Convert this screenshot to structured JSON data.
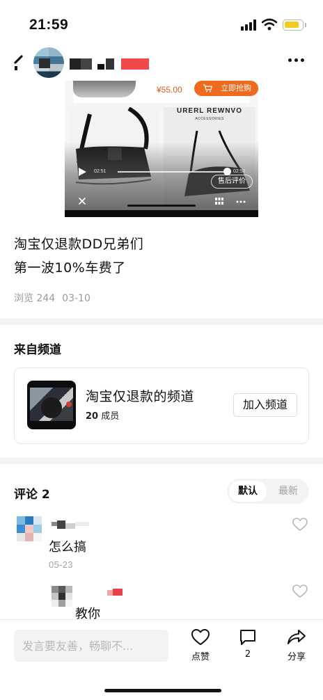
{
  "status_bar": {
    "time": "21:59",
    "battery_level": 0.85,
    "battery_color": "#f2cb1c"
  },
  "header": {
    "back_icon": "back-arrow-icon",
    "more_icon": "more-dots-icon"
  },
  "video": {
    "price": "¥55.00",
    "buy_label": "立即抢购",
    "brand": "URERL REWNVO",
    "brand_sub": "ACCESSORIES",
    "time_current": "02:51",
    "time_total": "02:53",
    "progress": 0.98,
    "review_label": "售后评价"
  },
  "post": {
    "line1": "淘宝仅退款DD兄弟们",
    "line2": "第一波10%车费了",
    "views": "浏览 244",
    "date": "03-10"
  },
  "channel": {
    "section_title": "来自频道",
    "name": "淘宝仅退款的频道",
    "member_count": "20",
    "member_unit": "成员",
    "join_label": "加入频道"
  },
  "comments": {
    "title": "评论 2",
    "sort_default": "默认",
    "sort_latest": "最新",
    "items": [
      {
        "text": "怎么搞",
        "date": "05-23"
      },
      {
        "text": "教你"
      }
    ]
  },
  "bottom_bar": {
    "input_placeholder": "发言要友善，畅聊不...",
    "like_label": "点赞",
    "comment_count": "2",
    "share_label": "分享",
    "accent_color": "#f06a1d"
  }
}
